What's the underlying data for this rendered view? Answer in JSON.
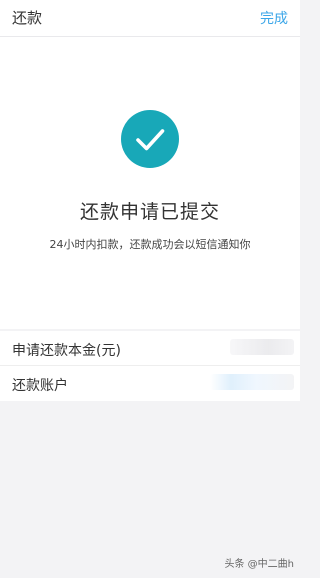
{
  "header": {
    "title": "还款",
    "done_label": "完成"
  },
  "success": {
    "icon": "checkmark-icon",
    "title": "还款申请已提交",
    "description": "24小时内扣款，还款成功会以短信通知你"
  },
  "info_rows": [
    {
      "label": "申请还款本金(元)"
    },
    {
      "label": "还款账户"
    }
  ],
  "watermark": "头条 @中二曲h",
  "colors": {
    "accent": "#18a8b8",
    "link": "#3ba6e8",
    "background": "#f3f3f5"
  }
}
